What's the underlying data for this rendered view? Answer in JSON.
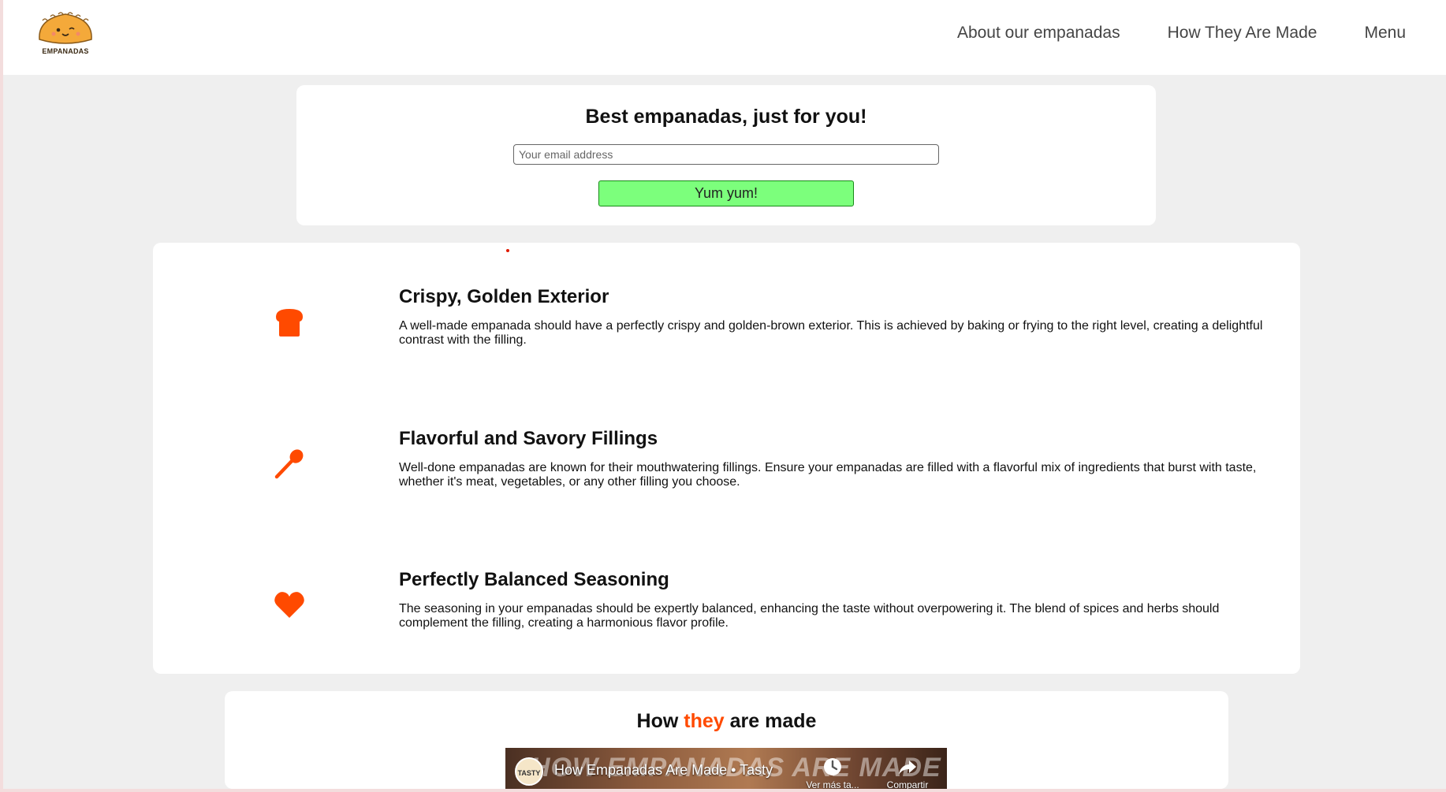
{
  "header": {
    "logo_text": "EMPANADAS",
    "nav": [
      {
        "label": "About our empanadas"
      },
      {
        "label": "How They Are Made"
      },
      {
        "label": "Menu"
      }
    ]
  },
  "signup": {
    "title": "Best empanadas, just for you!",
    "email_placeholder": "Your email address",
    "email_value": "",
    "button_label": "Yum yum!"
  },
  "features": [
    {
      "icon": "bread-icon",
      "title": "Crispy, Golden Exterior",
      "text": "A well-made empanada should have a perfectly crispy and golden-brown exterior. This is achieved by baking or frying to the right level, creating a delightful contrast with the filling."
    },
    {
      "icon": "spoon-icon",
      "title": "Flavorful and Savory Fillings",
      "text": "Well-done empanadas are known for their mouthwatering fillings. Ensure your empanadas are filled with a flavorful mix of ingredients that burst with taste, whether it's meat, vegetables, or any other filling you choose."
    },
    {
      "icon": "heart-icon",
      "title": "Perfectly Balanced Seasoning",
      "text": "The seasoning in your empanadas should be expertly balanced, enhancing the taste without overpowering it. The blend of spices and herbs should complement the filling, creating a harmonious flavor profile."
    }
  ],
  "video_section": {
    "title_before": "How",
    "title_accent": "they",
    "title_after": "are made",
    "video_title": "How Empanadas Are Made • Tasty",
    "video_overlay_text": "HOW EMPANADAS ARE MADE",
    "channel_badge": "TASTY",
    "watch_later_label": "Ver más ta...",
    "share_label": "Compartir"
  },
  "colors": {
    "accent": "#ff4a00",
    "button_bg": "#7cff7c",
    "page_bg": "#efefef"
  }
}
